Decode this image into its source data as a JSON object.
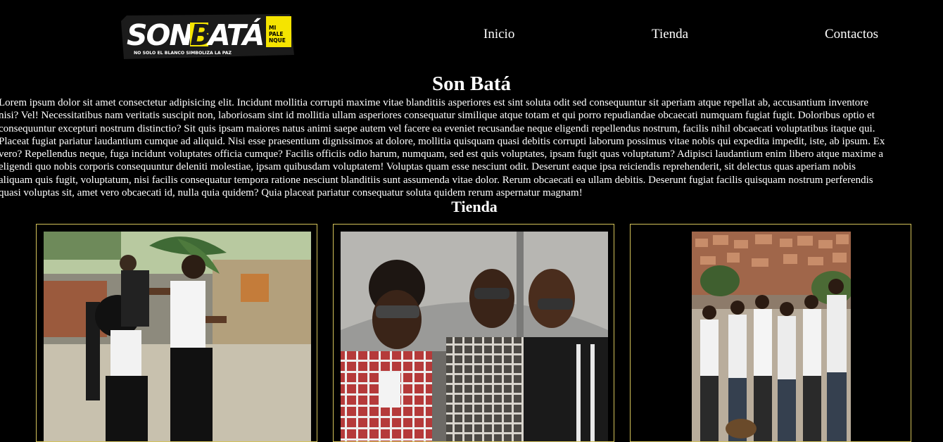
{
  "brand": {
    "logo_text": "SONBATÁ",
    "logo_side_text": "MI PALENQUE",
    "logo_tagline": "NO SOLO EL BLANCO SIMBOLIZA LA PAZ",
    "accent_color": "#f5e400"
  },
  "nav": {
    "items": [
      "Inicio",
      "Tienda",
      "Contactos"
    ]
  },
  "main": {
    "title": "Son Batá",
    "intro_lines": [
      "Lorem ipsum dolor sit amet consectetur adipisicing elit. Incidunt mollitia corrupti maxime vitae blanditiis asperiores est sint soluta odit sed consequuntur sit aperiam atque repellat ab, accusantium inventore",
      "nisi? Vel! Necessitatibus nam veritatis suscipit non, laboriosam sint id mollitia ullam asperiores consequatur similique atque totam et qui porro repudiandae obcaecati numquam fugiat fugit. Doloribus optio et",
      "consequuntur excepturi nostrum distinctio? Sit quis ipsam maiores natus animi saepe autem vel facere ea eveniet recusandae neque eligendi repellendus nostrum, facilis nihil obcaecati voluptatibus itaque qui.",
      "Placeat fugiat pariatur laudantium cumque ad aliquid. Nisi esse praesentium dignissimos at dolore, mollitia quisquam quasi debitis corrupti laborum possimus vitae nobis qui expedita impedit, iste, ab ipsum. Ex",
      "vero? Repellendus neque, fuga incidunt voluptates officia cumque? Facilis officiis odio harum, numquam, sed est quis voluptates, ipsam fugit quas voluptatum? Adipisci laudantium enim libero atque maxime a",
      "eligendi quo nobis corporis consequuntur deleniti molestiae, ipsam quibusdam voluptatem! Voluptas quam esse nesciunt odit. Deserunt eaque ipsa reiciendis reprehenderit, sit delectus quas aperiam nobis",
      "aliquam quis fugit, voluptatum, nisi facilis consequatur tempora ratione nesciunt blanditiis sunt assumenda vitae dolor. Rerum obcaecati ea ullam debitis. Deserunt fugiat facilis quisquam nostrum perferendis",
      "quasi voluptas sit, amet vero obcaecati id, nulla quia quidem? Quia placeat pariatur consequatur soluta quidem rerum aspernatur magnam!"
    ]
  },
  "store": {
    "title": "Tienda",
    "border_color": "#d4c35a",
    "products": [
      {
        "photo": "dancers-photo"
      },
      {
        "photo": "band-members-photo"
      },
      {
        "photo": "group-neighborhood-photo"
      }
    ]
  }
}
